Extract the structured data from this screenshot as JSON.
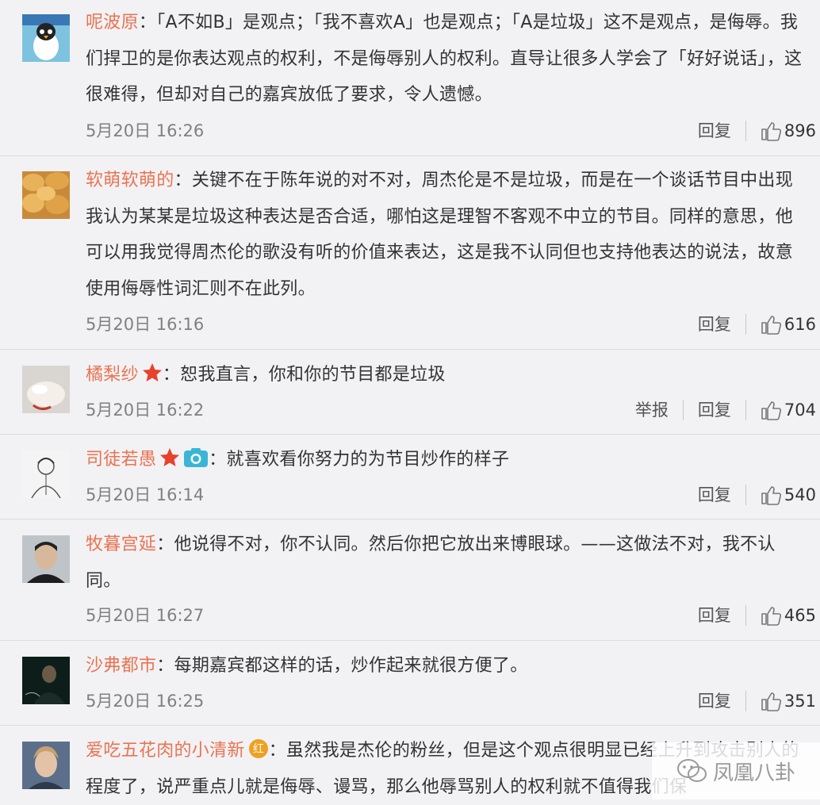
{
  "comments": [
    {
      "author": "呢波原",
      "text": "「A不如B」是观点；「我不喜欢A」也是观点；「A是垃圾」这不是观点，是侮辱。我们捍卫的是你表达观点的权利，不是侮辱别人的权利。直导让很多人学会了「好好说话」，这很难得，但却对自己的嘉宾放低了要求，令人遗憾。",
      "time": "5月20日 16:26",
      "reply": "回复",
      "likes": "896"
    },
    {
      "author": "软萌软萌的",
      "text": "关键不在于陈年说的对不对，周杰伦是不是垃圾，而是在一个谈话节目中出现我认为某某是垃圾这种表达是否合适，哪怕这是理智不客观不中立的节目。同样的意思，他可以用我觉得周杰伦的歌没有听的价值来表达，这是我不认同但也支持他表达的说法，故意使用侮辱性词汇则不在此列。",
      "time": "5月20日 16:16",
      "reply": "回复",
      "likes": "616"
    },
    {
      "author": "橘梨纱",
      "text": "恕我直言，你和你的节目都是垃圾",
      "time": "5月20日 16:22",
      "report": "举报",
      "reply": "回复",
      "likes": "704"
    },
    {
      "author": "司徒若愚",
      "text": "就喜欢看你努力的为节目炒作的样子",
      "time": "5月20日 16:14",
      "reply": "回复",
      "likes": "540"
    },
    {
      "author": "牧暮宫延",
      "text": "他说得不对，你不认同。然后你把它放出来博眼球。——这做法不对，我不认同。",
      "time": "5月20日 16:27",
      "reply": "回复",
      "likes": "465"
    },
    {
      "author": "沙弗都市",
      "text": "每期嘉宾都这样的话，炒作起来就很方便了。",
      "time": "5月20日 16:25",
      "reply": "回复",
      "likes": "351"
    },
    {
      "author": "爱吃五花肉的小清新",
      "badge_text": "红",
      "text": "虽然我是杰伦的粉丝，但是这个观点很明显已经上升到攻击别人的程度了，说严重点儿就是侮辱、谩骂，那么他辱骂别人的权利就不值得我们保"
    }
  ],
  "separator": "：",
  "watermark": "凤凰八卦",
  "colors": {
    "author": "#eb7350",
    "background": "#f2f2f5",
    "star": "#e8412c",
    "camera": "#3ab5d6"
  },
  "icons": {
    "like": "thumbs-up-icon",
    "star": "star-badge-icon",
    "camera": "camera-badge-icon",
    "watermark": "wechat-icon"
  }
}
